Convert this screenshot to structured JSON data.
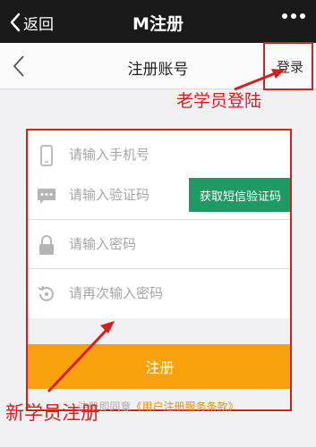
{
  "appbar": {
    "back_label": "返回",
    "title": "M注册"
  },
  "page": {
    "title": "注册账号",
    "login_label": "登录"
  },
  "annotations": {
    "old_student": "老学员登陆",
    "new_student": "新学员注册"
  },
  "form": {
    "phone_placeholder": "请输入手机号",
    "code_placeholder": "请输入验证码",
    "sms_button": "获取短信验证码",
    "password_placeholder": "请输入密码",
    "confirm_placeholder": "请再次输入密码",
    "submit_label": "注册"
  },
  "terms": {
    "agree_text": "注册即同意",
    "link_text": "《用户注册服务条款》"
  },
  "colors": {
    "accent_green": "#1e9b65",
    "submit_orange": "#f7a10d",
    "annotation_red": "#d22020"
  }
}
